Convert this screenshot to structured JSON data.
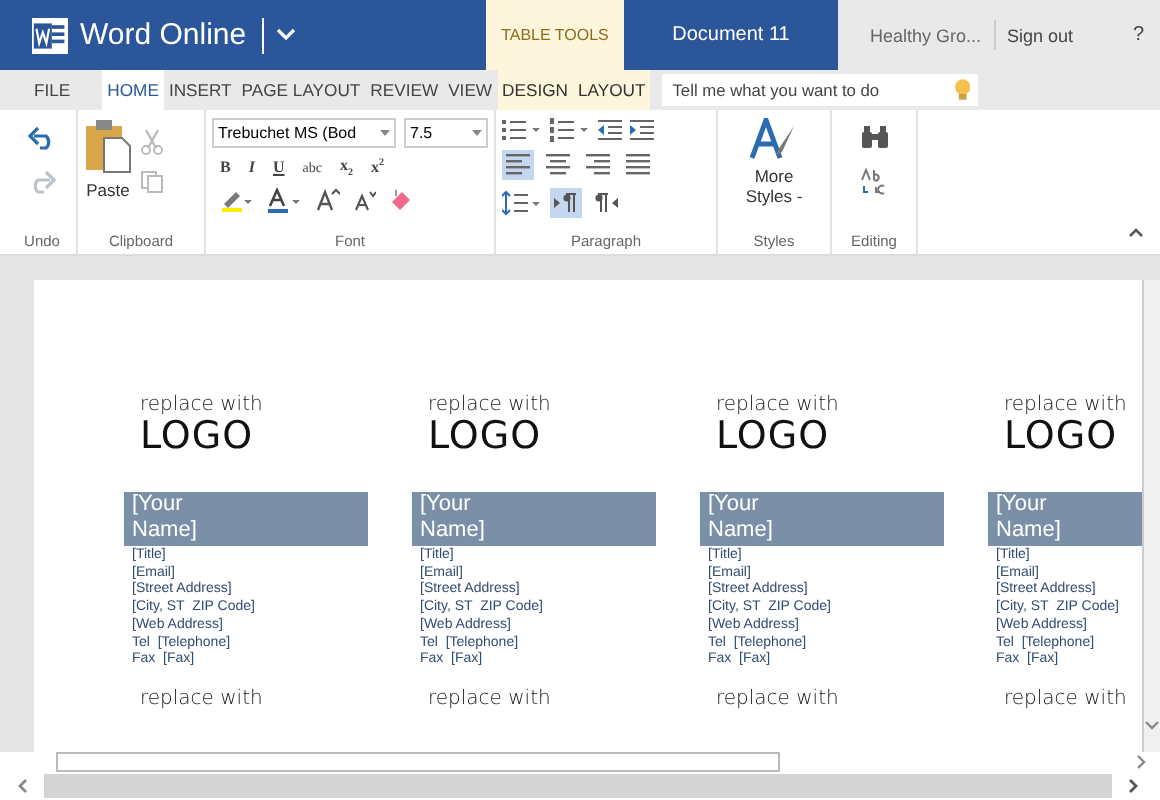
{
  "title_bar": {
    "app_name": "Word Online",
    "context_label": "TABLE TOOLS",
    "document": "Document 11",
    "user": "Healthy Gro...",
    "sign_out": "Sign out",
    "help": "?"
  },
  "menu_tabs": [
    {
      "label": "FILE",
      "selected": false,
      "kind": "standard"
    },
    {
      "label": "HOME",
      "selected": true,
      "kind": "standard"
    },
    {
      "label": "INSERT",
      "selected": false,
      "kind": "standard"
    },
    {
      "label": "PAGE LAYOUT",
      "selected": false,
      "kind": "standard"
    },
    {
      "label": "REVIEW",
      "selected": false,
      "kind": "standard"
    },
    {
      "label": "VIEW",
      "selected": false,
      "kind": "standard"
    },
    {
      "label": "DESIGN",
      "selected": false,
      "kind": "contextual"
    },
    {
      "label": "LAYOUT",
      "selected": false,
      "kind": "contextual"
    }
  ],
  "search": {
    "placeholder": "Tell me what you want to do"
  },
  "ribbon": {
    "undo_group": "Undo",
    "clipboard_group": "Clipboard",
    "paste": "Paste",
    "font_group": "Font",
    "font_name": "Trebuchet MS (Bod",
    "font_size": "7.5",
    "format_buttons": [
      "B",
      "I",
      "U",
      "abc",
      "x$_{2}$",
      "x$^{2}$"
    ],
    "paragraph_group": "Paragraph",
    "alignment": [
      {
        "selected": true
      },
      {
        "selected": false
      },
      {
        "selected": false
      },
      {
        "selected": false
      }
    ],
    "direction": [
      {
        "selected": true
      },
      {
        "selected": false
      }
    ],
    "more_styles": "More Styles -",
    "styles_group": "Styles",
    "editing_group": "Editing"
  },
  "cards": [
    {
      "logo_caption": "replace with",
      "logo": "LOGO",
      "name": "[Your Name]",
      "details": [
        "[Title]",
        "[Email]",
        "[Street Address]",
        "[City, ST  ZIP Code]",
        "[Web Address]",
        "Tel  [Telephone]",
        "Fax  [Fax]"
      ],
      "next_caption": "replace with"
    },
    {
      "logo_caption": "replace with",
      "logo": "LOGO",
      "name": "[Your Name]",
      "details": [
        "[Title]",
        "[Email]",
        "[Street Address]",
        "[City, ST  ZIP Code]",
        "[Web Address]",
        "Tel  [Telephone]",
        "Fax  [Fax]"
      ],
      "next_caption": "replace with"
    },
    {
      "logo_caption": "replace with",
      "logo": "LOGO",
      "name": "[Your Name]",
      "details": [
        "[Title]",
        "[Email]",
        "[Street Address]",
        "[City, ST  ZIP Code]",
        "[Web Address]",
        "Tel  [Telephone]",
        "Fax  [Fax]"
      ],
      "next_caption": "replace with"
    },
    {
      "logo_caption": "replace with",
      "logo": "LOGO",
      "name": "[Your Name]",
      "details": [
        "[Title]",
        "[Email]",
        "[Street Address]",
        "[City, ST  ZIP Code]",
        "[Web Address]",
        "Tel  [Telephone]",
        "Fax  [Fax]"
      ],
      "next_caption": "replace with"
    }
  ]
}
